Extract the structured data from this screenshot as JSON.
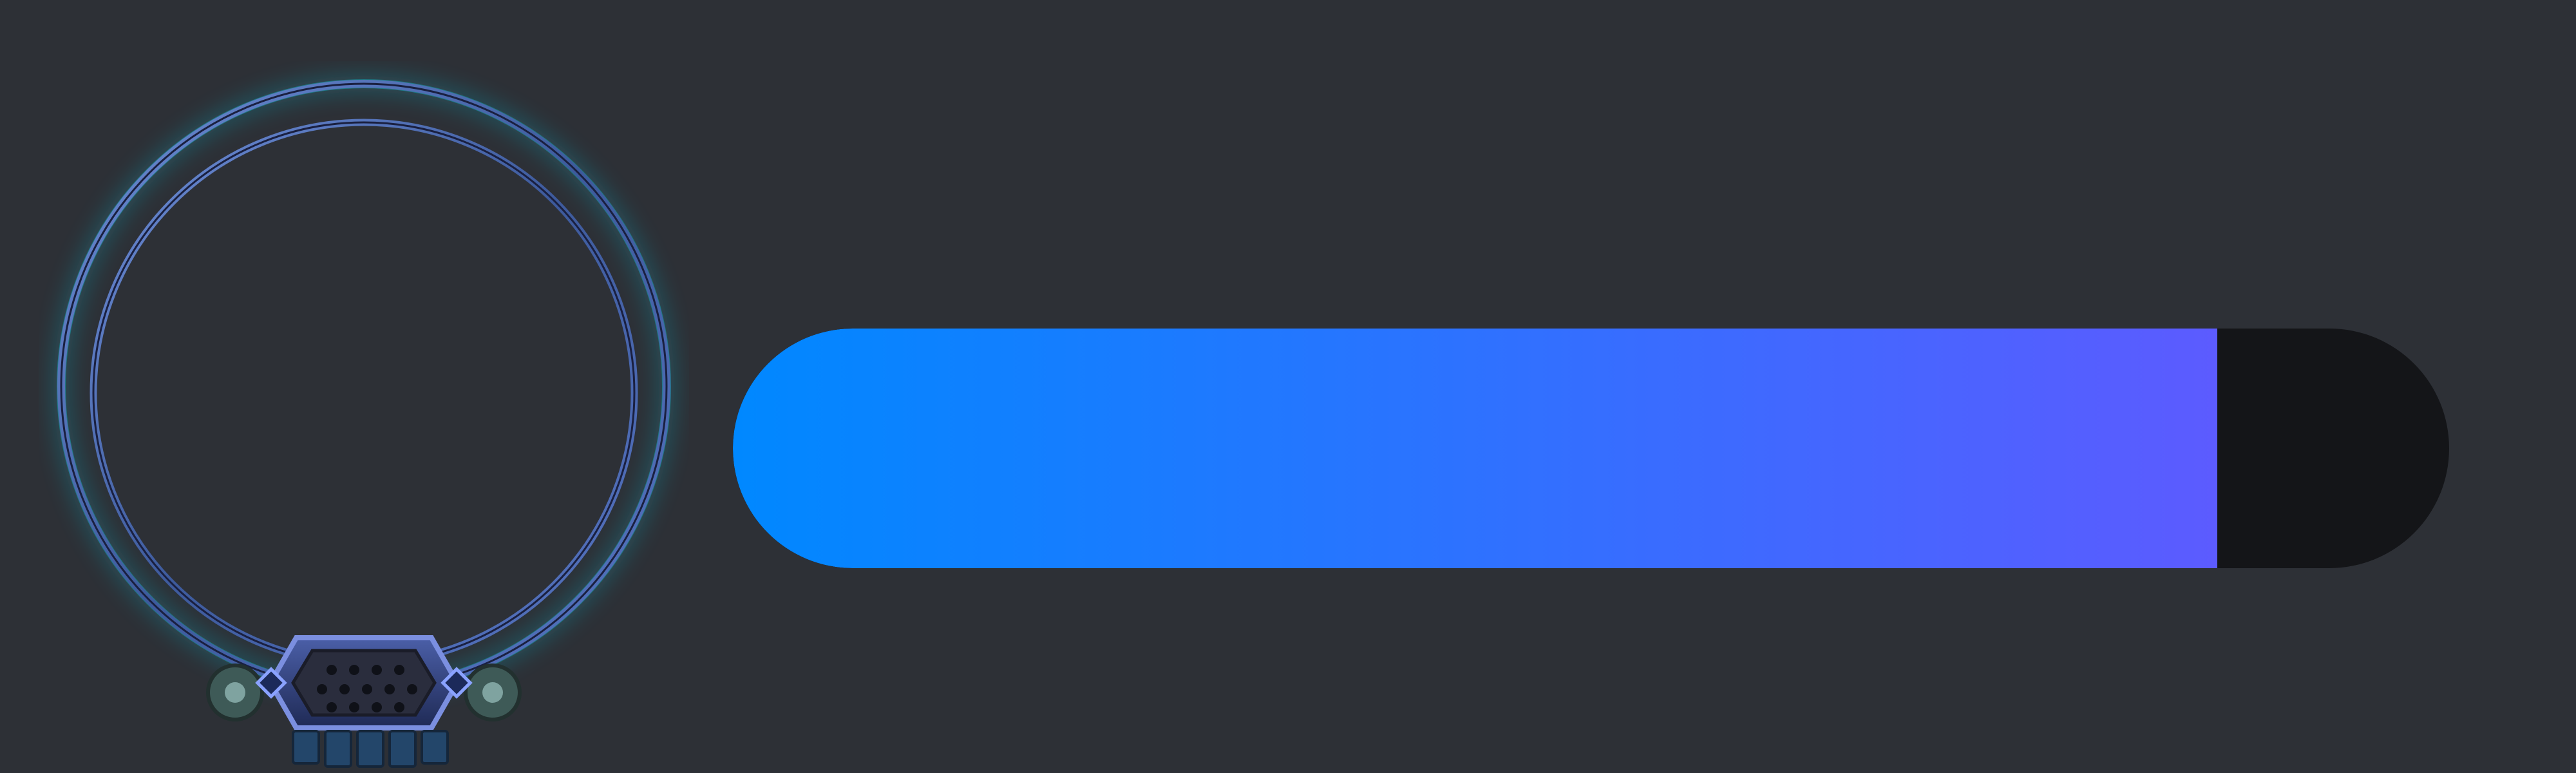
{
  "hud": {
    "avatar_frame": {
      "icon": "portrait-ring-frame-icon",
      "glow_color": "#12b3c9",
      "ring_color": "#4a6fb5",
      "plate_color": "#2c3a6e"
    },
    "progress_bar": {
      "fill_fraction": 0.865,
      "fill_gradient_start": "#0088ff",
      "fill_gradient_end": "#5c5bff",
      "track_color": "#141518"
    }
  }
}
